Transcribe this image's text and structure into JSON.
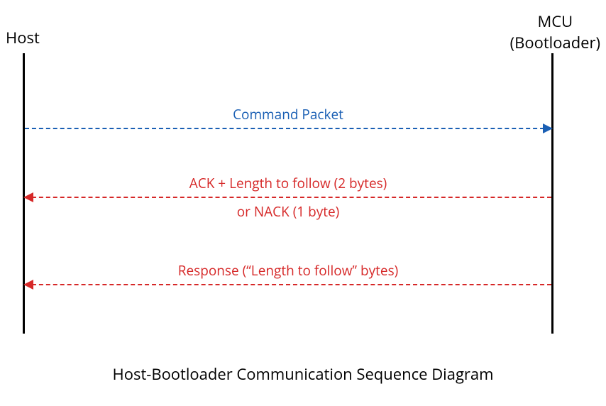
{
  "actors": {
    "left": "Host",
    "right_line1": "MCU",
    "right_line2": "(Bootloader)"
  },
  "messages": {
    "m1": {
      "label": "Command Packet",
      "direction": "right",
      "color": "blue"
    },
    "m2": {
      "label_above": "ACK + Length to follow (2 bytes)",
      "label_below": "or NACK (1 byte)",
      "direction": "left",
      "color": "red"
    },
    "m3": {
      "label": "Response (“Length to follow” bytes)",
      "direction": "left",
      "color": "red"
    }
  },
  "caption": "Host-Bootloader Communication Sequence Diagram",
  "colors": {
    "blue": "#1a5fb4",
    "red": "#d62828"
  }
}
